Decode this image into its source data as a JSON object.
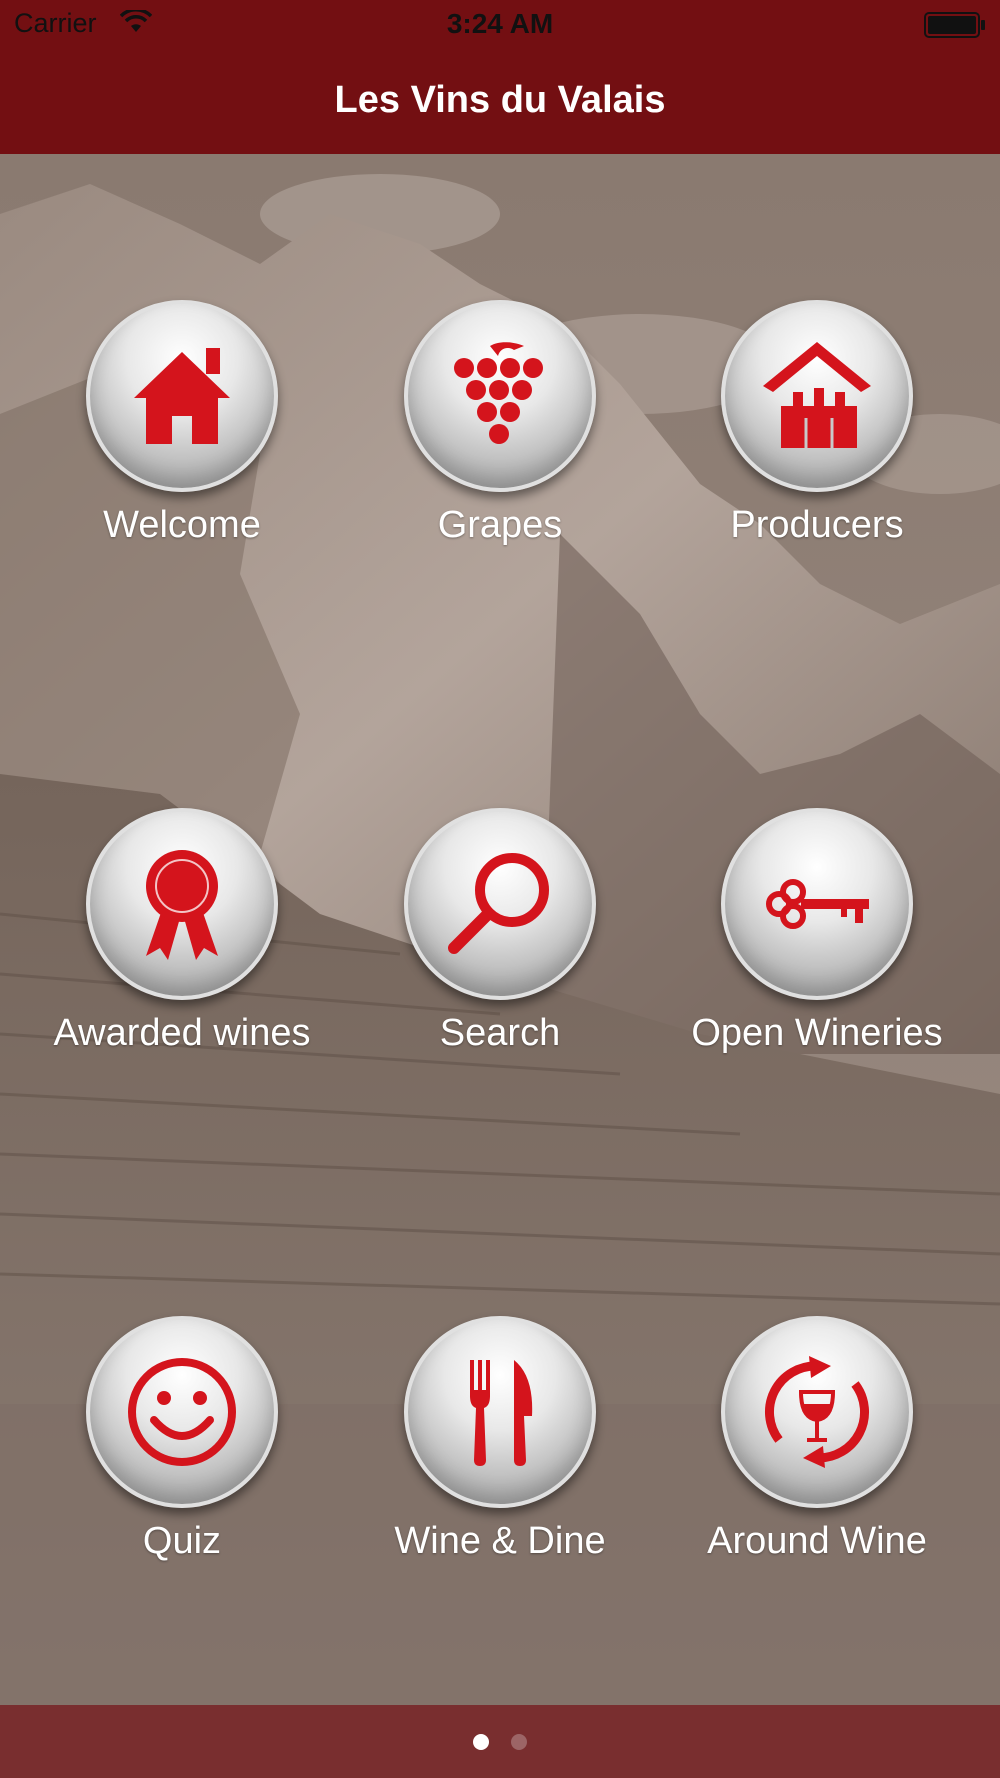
{
  "status_bar": {
    "carrier": "Carrier",
    "time": "3:24 AM"
  },
  "nav": {
    "title": "Les Vins du Valais"
  },
  "colors": {
    "bar": "#730f12",
    "footer": "#792e2f",
    "icon_red": "#d4141c",
    "dot_active": "#ffffff",
    "dot_inactive": "#9c6566"
  },
  "menu": [
    {
      "label": "Welcome",
      "icon": "house-icon"
    },
    {
      "label": "Grapes",
      "icon": "grapes-icon"
    },
    {
      "label": "Producers",
      "icon": "winery-icon"
    },
    {
      "label": "Awarded wines",
      "icon": "award-ribbon-icon"
    },
    {
      "label": "Search",
      "icon": "magnifier-icon"
    },
    {
      "label": "Open Wineries",
      "icon": "key-icon"
    },
    {
      "label": "Quiz",
      "icon": "smiley-icon"
    },
    {
      "label": "Wine & Dine",
      "icon": "fork-knife-icon"
    },
    {
      "label": "Around Wine",
      "icon": "wine-glass-cycle-icon"
    }
  ],
  "pager": {
    "pages": 2,
    "current": 1
  }
}
